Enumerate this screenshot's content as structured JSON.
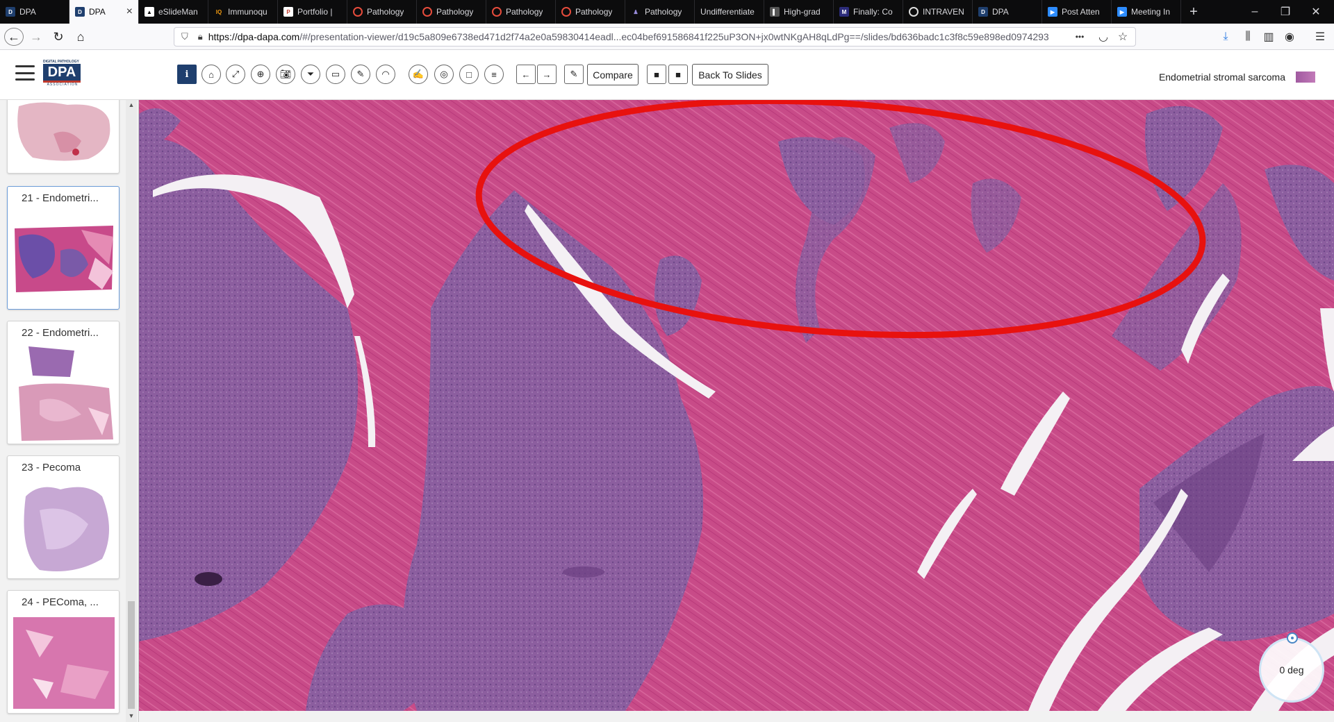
{
  "browser": {
    "tabs": [
      {
        "label": "DPA",
        "icon": "dpa-icon",
        "active": false
      },
      {
        "label": "DPA",
        "icon": "dpa-icon",
        "active": true
      },
      {
        "label": "eSlideMan",
        "icon": "eslide-icon",
        "active": false
      },
      {
        "label": "Immunoqu",
        "icon": "iq-icon",
        "active": false
      },
      {
        "label": "Portfolio |",
        "icon": "portfolio-icon",
        "active": false
      },
      {
        "label": "Pathology",
        "icon": "pathology-icon",
        "active": false
      },
      {
        "label": "Pathology",
        "icon": "pathology-icon",
        "active": false
      },
      {
        "label": "Pathology",
        "icon": "pathology-icon",
        "active": false
      },
      {
        "label": "Pathology",
        "icon": "pathology-icon",
        "active": false
      },
      {
        "label": "Pathology",
        "icon": "pathology-icon",
        "active": false
      },
      {
        "label": "Undifferentiate",
        "icon": "",
        "active": false
      },
      {
        "label": "High-grad",
        "icon": "doc-icon",
        "active": false
      },
      {
        "label": "Finally: Co",
        "icon": "doc-icon",
        "active": false
      },
      {
        "label": "INTRAVEN",
        "icon": "chrome-icon",
        "active": false
      },
      {
        "label": "DPA",
        "icon": "dpa-icon",
        "active": false
      },
      {
        "label": "Post Atten",
        "icon": "zoom-icon",
        "active": false
      },
      {
        "label": "Meeting In",
        "icon": "zoom-icon",
        "active": false
      }
    ],
    "active_tab_close": "×",
    "new_tab": "+",
    "window_controls": {
      "minimize": "–",
      "restore": "❐",
      "close": "✕"
    },
    "url_host": "https://dpa-dapa.com",
    "url_path": "/#/presentation-viewer/d19c5a809e6738ed471d2f74a2e0a59830414eadl...ec04bef691586841f225uP3ON+jx0wtNKgAH8qLdPg==/slides/bd636badc1c3f8c59e898ed0974293",
    "url_overflow": "•••"
  },
  "app": {
    "logo_top": "DIGITAL PATHOLOGY",
    "logo_text": "DPA",
    "logo_bottom": "ASSOCIATION",
    "toolbar": {
      "info": "i",
      "compare_label": "Compare",
      "back_label": "Back To Slides"
    },
    "slide_title": "Endometrial stromal sarcoma"
  },
  "sidebar": {
    "items": [
      {
        "title": "",
        "selected": false
      },
      {
        "title": "21 - Endometri...",
        "selected": true
      },
      {
        "title": "22 - Endometri...",
        "selected": false
      },
      {
        "title": "23 - Pecoma",
        "selected": false
      },
      {
        "title": "24 - PEComa, ...",
        "selected": false
      }
    ]
  },
  "viewer": {
    "rotation_label": "0 deg",
    "annotation": {
      "shape": "ellipse",
      "color": "#e8110f"
    }
  },
  "colors": {
    "stroma_pink": "#c94a86",
    "tumor_purple": "#8a5b9c",
    "annotation_red": "#e8110f",
    "brand_navy": "#1f3f6e"
  }
}
